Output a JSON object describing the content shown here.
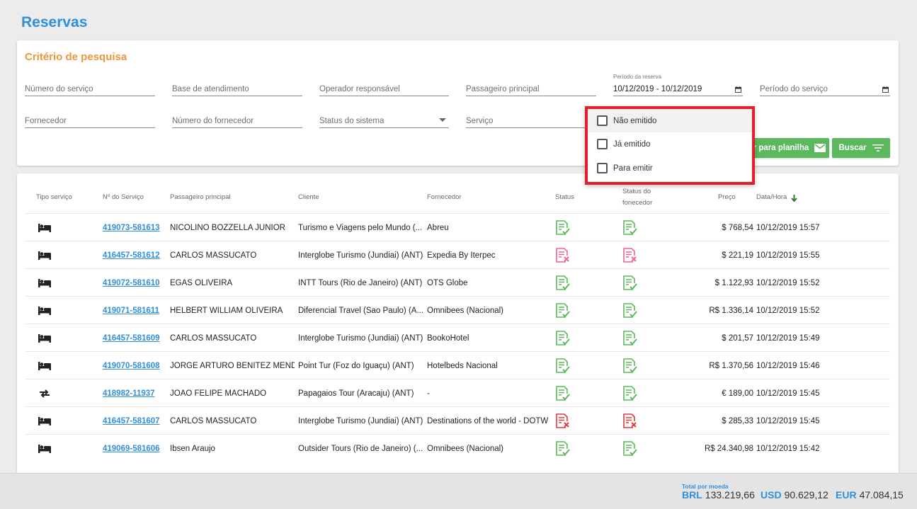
{
  "page_title": "Reservas",
  "criteria": {
    "title": "Critério de pesquisa",
    "fields": {
      "numero_servico": "Número do serviço",
      "base_atendimento": "Base de atendimento",
      "operador": "Operador responsável",
      "passageiro": "Passageiro principal",
      "periodo_reserva_label": "Período da reserva",
      "periodo_reserva_value": "10/12/2019 - 10/12/2019",
      "periodo_servico": "Período do serviço",
      "fornecedor": "Fornecedor",
      "numero_fornecedor": "Número do fornecedor",
      "status_sistema": "Status do sistema",
      "servico": "Serviço"
    },
    "export_label": "r para planilha",
    "search_label": "Buscar"
  },
  "dropdown": {
    "options": [
      "Não emitido",
      "Já emitido",
      "Para emitir"
    ]
  },
  "table": {
    "headers": {
      "tipo": "Tipo serviço",
      "numero": "Nº do Serviço",
      "passageiro": "Passageiro principal",
      "cliente": "Cliente",
      "fornecedor": "Fornecedor",
      "status": "Status",
      "status_fornecedor_1": "Status do",
      "status_fornecedor_2": "fonecedor",
      "preco": "Preço",
      "data": "Data/Hora"
    },
    "rows": [
      {
        "type": "hotel",
        "numero": "419073-581613",
        "passageiro": "NICOLINO BOZZELLA JUNIOR",
        "cliente": "Turismo e Viagens pelo Mundo (...",
        "fornecedor": "Abreu",
        "status": "ok",
        "status_forn": "ok",
        "preco": "$ 768,54",
        "data": "10/12/2019 15:57"
      },
      {
        "type": "hotel",
        "numero": "416457-581612",
        "passageiro": "CARLOS MASSUCATO",
        "cliente": "Interglobe Turismo (Jundiai) (ANT)",
        "fornecedor": "Expedia By Iterpec",
        "status": "cancel-pink",
        "status_forn": "cancel-pink",
        "preco": "$ 221,19",
        "data": "10/12/2019 15:55"
      },
      {
        "type": "hotel",
        "numero": "419072-581610",
        "passageiro": "EGAS OLIVEIRA",
        "cliente": "INTT Tours (Rio de Janeiro) (ANT)",
        "fornecedor": "OTS Globe",
        "status": "ok",
        "status_forn": "ok",
        "preco": "$ 1.122,93",
        "data": "10/12/2019 15:52"
      },
      {
        "type": "hotel",
        "numero": "419071-581611",
        "passageiro": "HELBERT WILLIAM OLIVEIRA",
        "cliente": "Diferencial Travel (Sao Paulo) (A...",
        "fornecedor": "Omnibees (Nacional)",
        "status": "ok",
        "status_forn": "ok",
        "preco": "R$ 1.336,14",
        "data": "10/12/2019 15:52"
      },
      {
        "type": "hotel",
        "numero": "416457-581609",
        "passageiro": "CARLOS MASSUCATO",
        "cliente": "Interglobe Turismo (Jundiai) (ANT)",
        "fornecedor": "BookoHotel",
        "status": "ok",
        "status_forn": "ok",
        "preco": "$ 201,57",
        "data": "10/12/2019 15:49"
      },
      {
        "type": "hotel",
        "numero": "419070-581608",
        "passageiro": "JORGE ARTURO BENITEZ MENDI...",
        "cliente": "Point Tur (Foz do Iguaçu) (ANT)",
        "fornecedor": "Hotelbeds Nacional",
        "status": "ok",
        "status_forn": "ok",
        "preco": "R$ 1.370,56",
        "data": "10/12/2019 15:46"
      },
      {
        "type": "transfer",
        "numero": "418982-11937",
        "passageiro": "JOAO FELIPE MACHADO",
        "cliente": "Papagaios Tour (Aracaju) (ANT)",
        "fornecedor": "-",
        "status": "ok",
        "status_forn": "ok",
        "preco": "€ 189,00",
        "data": "10/12/2019 15:45"
      },
      {
        "type": "hotel",
        "numero": "416457-581607",
        "passageiro": "CARLOS MASSUCATO",
        "cliente": "Interglobe Turismo (Jundiai) (ANT)",
        "fornecedor": "Destinations of the world - DOTW",
        "status": "cancel-red",
        "status_forn": "cancel-red",
        "preco": "$ 285,33",
        "data": "10/12/2019 15:45"
      },
      {
        "type": "hotel",
        "numero": "419069-581606",
        "passageiro": "Ibsen Araujo",
        "cliente": "Outsider Tours (Rio de Janeiro) (...",
        "fornecedor": "Omnibees (Nacional)",
        "status": "ok",
        "status_forn": "ok",
        "preco": "R$ 24.340,98",
        "data": "10/12/2019 15:42"
      }
    ]
  },
  "footer": {
    "total_label": "Total por moeda",
    "totals": [
      {
        "currency": "BRL",
        "value": "133.219,66"
      },
      {
        "currency": "USD",
        "value": "90.629,12"
      },
      {
        "currency": "EUR",
        "value": "47.084,15"
      }
    ]
  },
  "colors": {
    "accent_blue": "#2f8fdd",
    "accent_orange": "#f0953a",
    "ok_green": "#5cb85c",
    "cancel_pink": "#f06292",
    "cancel_red": "#e53935",
    "highlight_red": "#e0202e"
  }
}
